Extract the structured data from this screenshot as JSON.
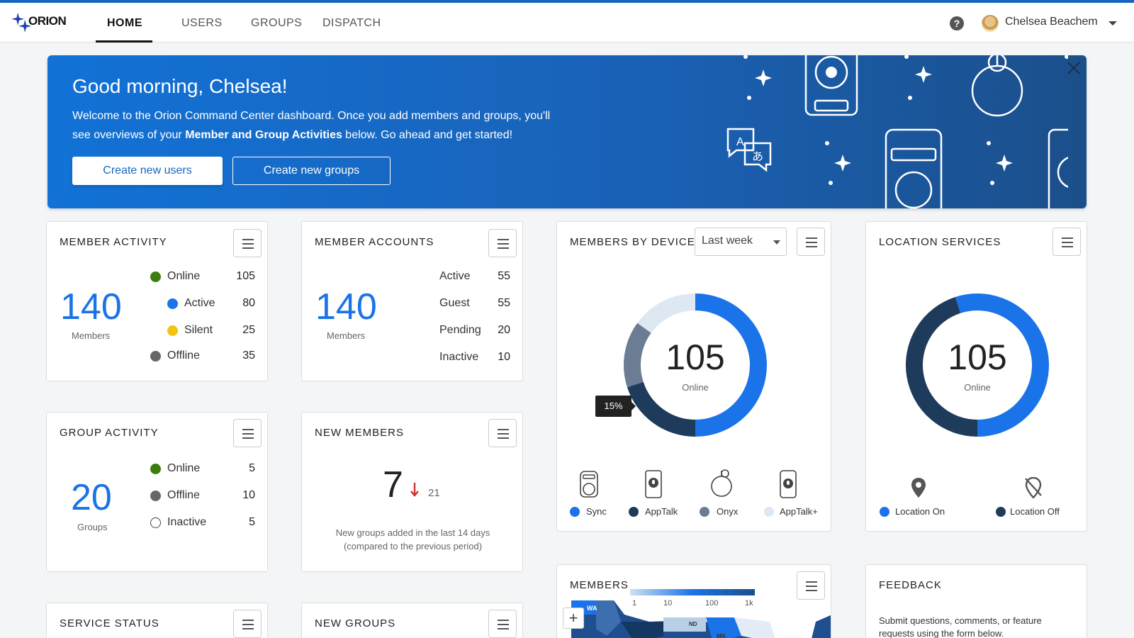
{
  "brand": {
    "name": "ORION"
  },
  "nav": {
    "items": [
      {
        "label": "HOME",
        "active": true
      },
      {
        "label": "USERS",
        "active": false
      },
      {
        "label": "GROUPS",
        "active": false
      },
      {
        "label": "DISPATCH",
        "active": false
      }
    ]
  },
  "user": {
    "name": "Chelsea Beachem"
  },
  "banner": {
    "title": "Good morning, Chelsea!",
    "text_before": "Welcome to the Orion Command Center dashboard. Once you add members and groups, you'll see overviews of your ",
    "text_bold": "Member and Group Activities",
    "text_after": " below. Go ahead and get started!",
    "primary_button": "Create new users",
    "secondary_button": "Create new groups"
  },
  "member_activity": {
    "title": "MEMBER ACTIVITY",
    "total": "140",
    "total_label": "Members",
    "rows": [
      {
        "label": "Online",
        "value": "105",
        "color": "#3b7d0e"
      },
      {
        "label": "Active",
        "value": "80",
        "color": "#1a73e8"
      },
      {
        "label": "Silent",
        "value": "25",
        "color": "#f1c40f"
      },
      {
        "label": "Offline",
        "value": "35",
        "color": "#666666"
      }
    ]
  },
  "member_accounts": {
    "title": "MEMBER ACCOUNTS",
    "total": "140",
    "total_label": "Members",
    "rows": [
      {
        "label": "Active",
        "value": "55"
      },
      {
        "label": "Guest",
        "value": "55"
      },
      {
        "label": "Pending",
        "value": "20"
      },
      {
        "label": "Inactive",
        "value": "10"
      }
    ]
  },
  "members_by_device": {
    "title": "MEMBERS BY DEVICE",
    "period": "Last week",
    "center_value": "105",
    "center_label": "Online",
    "tooltip": "15%",
    "legend": [
      {
        "label": "Sync",
        "color": "#1a73e8"
      },
      {
        "label": "AppTalk",
        "color": "#1f3b5c"
      },
      {
        "label": "Onyx",
        "color": "#6b7c93"
      },
      {
        "label": "AppTalk+",
        "color": "#dde8f3"
      }
    ]
  },
  "location_services": {
    "title": "LOCATION SERVICES",
    "center_value": "105",
    "center_label": "Online",
    "legend": [
      {
        "label": "Location On",
        "color": "#1a73e8"
      },
      {
        "label": "Location Off",
        "color": "#1f3b5c"
      }
    ]
  },
  "group_activity": {
    "title": "GROUP ACTIVITY",
    "total": "20",
    "total_label": "Groups",
    "rows": [
      {
        "label": "Online",
        "value": "5",
        "color": "#3b7d0e"
      },
      {
        "label": "Offline",
        "value": "10",
        "color": "#666666"
      },
      {
        "label": "Inactive",
        "value": "5",
        "color": "#ffffff"
      }
    ]
  },
  "new_members": {
    "title": "NEW MEMBERS",
    "value": "7",
    "previous": "21",
    "line1": "New groups added in the last 14 days",
    "line2": "(compared to the previous period)"
  },
  "members_map": {
    "title": "MEMBERS",
    "scale": [
      "1",
      "10",
      "100",
      "1k"
    ],
    "zoom_in": "+",
    "states": [
      "WA",
      "ND",
      "MN"
    ]
  },
  "feedback": {
    "title": "FEEDBACK",
    "text": "Submit questions, comments, or feature requests using the form below."
  },
  "service_status": {
    "title": "SERVICE STATUS"
  },
  "new_groups": {
    "title": "NEW GROUPS"
  },
  "chart_data": [
    {
      "type": "pie",
      "title": "MEMBERS BY DEVICE",
      "categories": [
        "Sync",
        "AppTalk",
        "Onyx",
        "AppTalk+"
      ],
      "values": [
        50,
        20,
        15,
        15
      ]
    },
    {
      "type": "pie",
      "title": "LOCATION SERVICES",
      "categories": [
        "Location On",
        "Location Off"
      ],
      "values": [
        55,
        45
      ]
    }
  ]
}
